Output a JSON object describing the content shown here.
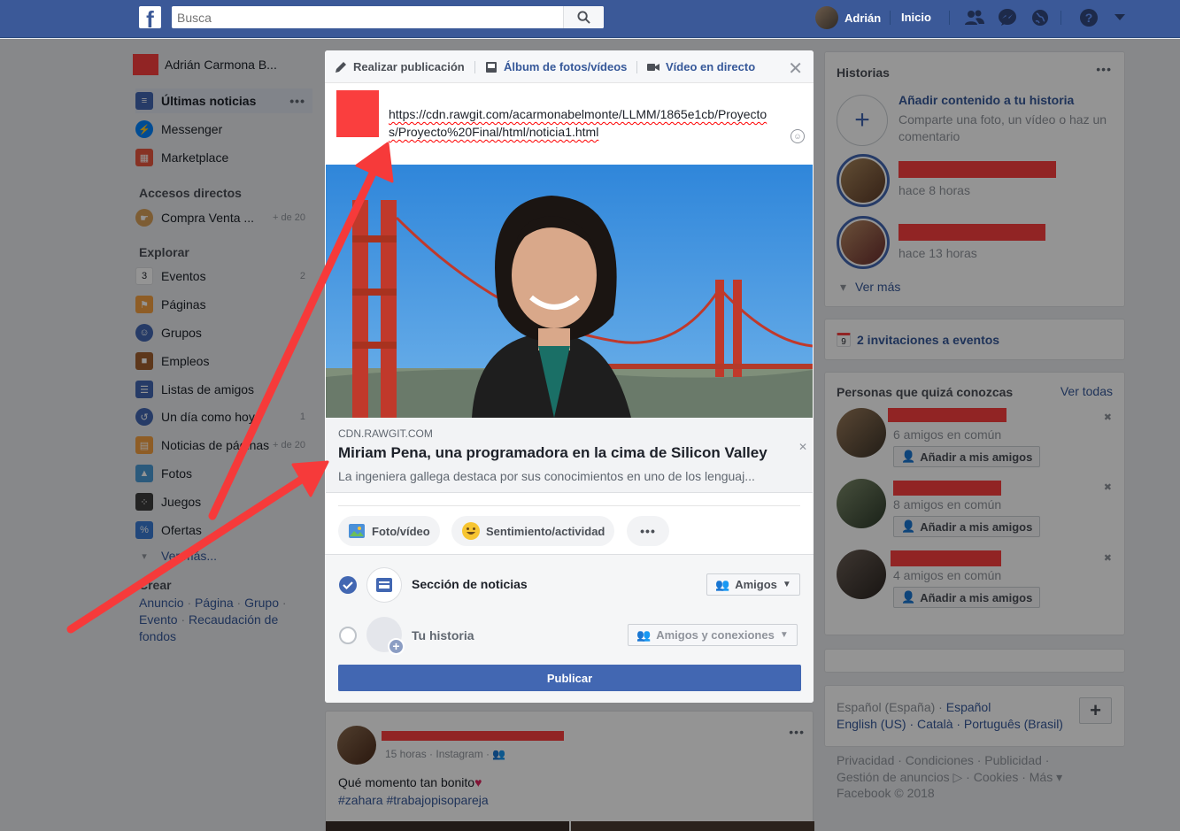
{
  "topbar": {
    "logo": "f",
    "search_placeholder": "Busca",
    "user_name": "Adrián",
    "home": "Inicio"
  },
  "left": {
    "user_name": "Adrián Carmona B...",
    "items": [
      {
        "label": "Últimas noticias",
        "icon": "news-feed-icon",
        "color": "#4267b2"
      },
      {
        "label": "Messenger",
        "icon": "messenger-icon",
        "color": "#0084ff"
      },
      {
        "label": "Marketplace",
        "icon": "marketplace-icon",
        "color": "#e9573f"
      }
    ],
    "shortcuts_title": "Accesos directos",
    "shortcut": {
      "label": "Compra Venta ...",
      "count": "+ de 20"
    },
    "explore_title": "Explorar",
    "explore": [
      {
        "label": "Eventos",
        "count": "2",
        "icon": "calendar-icon"
      },
      {
        "label": "Páginas",
        "count": "",
        "icon": "flag-icon"
      },
      {
        "label": "Grupos",
        "count": "",
        "icon": "groups-icon"
      },
      {
        "label": "Empleos",
        "count": "",
        "icon": "briefcase-icon"
      },
      {
        "label": "Listas de amigos",
        "count": "",
        "icon": "friend-list-icon"
      },
      {
        "label": "Un día como hoy",
        "count": "1",
        "icon": "memories-icon"
      },
      {
        "label": "Noticias de páginas",
        "count": "+ de 20",
        "icon": "pages-feed-icon"
      },
      {
        "label": "Fotos",
        "count": "",
        "icon": "photos-icon"
      },
      {
        "label": "Juegos",
        "count": "",
        "icon": "games-icon"
      },
      {
        "label": "Ofertas",
        "count": "",
        "icon": "offers-icon"
      }
    ],
    "see_more": "Ver más...",
    "create_title": "Crear",
    "create_links": [
      "Anuncio",
      "Página",
      "Grupo",
      "Evento",
      "Recaudación de fondos"
    ]
  },
  "modal": {
    "tabs": [
      "Realizar publicación",
      "Álbum de fotos/vídeos",
      "Vídeo en directo"
    ],
    "text": "https://cdn.rawgit.com/acarmonabelmonte/LLMM/1865e1cb/Proyectos/Proyecto%20Final/html/noticia1.html",
    "link_domain": "CDN.RAWGIT.COM",
    "link_title": "Miriam Pena, una programadora en la cima de Silicon Valley",
    "link_desc": "La ingeniera gallega destaca por sus conocimientos en uno de los lenguaj...",
    "actions": [
      "Foto/vídeo",
      "Sentimiento/actividad",
      "•••"
    ],
    "dest_news": "Sección de noticias",
    "dest_news_audience": "Amigos",
    "dest_story": "Tu historia",
    "dest_story_audience": "Amigos y conexiones",
    "publish": "Publicar"
  },
  "right": {
    "stories_title": "Historias",
    "add_story_title": "Añadir contenido a tu historia",
    "add_story_desc": "Comparte una foto, un vídeo o haz un comentario",
    "story_times": [
      "hace 8 horas",
      "hace 13 horas"
    ],
    "see_more": "Ver más",
    "invites": "2 invitaciones a eventos",
    "pymk_title": "Personas que quizá conozcas",
    "see_all": "Ver todas",
    "pymk": [
      {
        "mutual": "6 amigos en común"
      },
      {
        "mutual": "8 amigos en común"
      },
      {
        "mutual": "4 amigos en común"
      }
    ],
    "add_friend": "Añadir a mis amigos",
    "languages_line1": "Español (España) · ",
    "lang_es": "Español",
    "languages_line2": "English (US) · Català · Português (Brasil)",
    "footer_links": "Privacidad · Condiciones · Publicidad · Gestión de anuncios ▷ · Cookies · Más ▾",
    "copyright": "Facebook © 2018"
  },
  "feed": {
    "meta": "15 horas · Instagram ·",
    "text": "Qué momento tan bonito",
    "hashtags": "#zahara #trabajopisopareja"
  }
}
